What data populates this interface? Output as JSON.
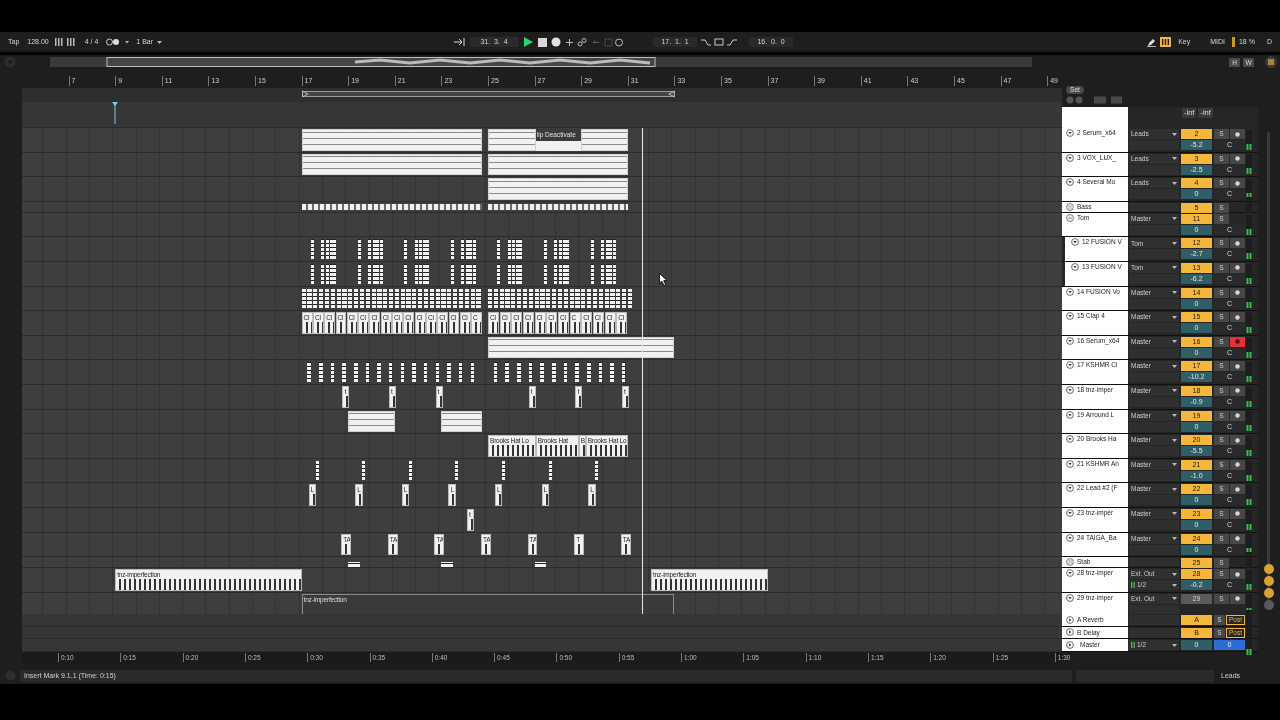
{
  "transport": {
    "tap": "Tap",
    "tempo": "128.00",
    "signature": "4 / 4",
    "quantize": "1 Bar",
    "position": "31.  3.  4",
    "playing": true,
    "loop_start": "17.  1.  1",
    "loop_length": "16.  0.  0",
    "key": "Key",
    "midi": "MIDI",
    "cpu": "18 %",
    "disk": "D"
  },
  "overview": {
    "buttons": [
      "H",
      "W"
    ]
  },
  "ruler": {
    "bars": [
      "7",
      "9",
      "11",
      "13",
      "15",
      "17",
      "19",
      "21",
      "23",
      "25",
      "27",
      "29",
      "31",
      "33",
      "35",
      "37",
      "39",
      "41",
      "43",
      "45",
      "47",
      "49"
    ]
  },
  "mixer_header": {
    "set": "Set",
    "peaks": [
      "-inf",
      "-inf"
    ]
  },
  "tracks": [
    {
      "name": "2 Serum_x64",
      "kind": "track",
      "output": "Leads",
      "number": "2",
      "volume": "-5.2",
      "pan": "C",
      "solo": "S",
      "armed": false,
      "active": true,
      "notice": "lip Deactivate"
    },
    {
      "name": "3 VOX_LUX_",
      "kind": "track",
      "output": "Leads",
      "number": "3",
      "volume": "-2.5",
      "pan": "C",
      "solo": "S",
      "armed": false,
      "active": true
    },
    {
      "name": "4 Several Mo",
      "kind": "track",
      "output": "Leads",
      "number": "4",
      "volume": "0",
      "pan": "C",
      "solo": "S",
      "armed": false,
      "active": true
    },
    {
      "name": "Bass",
      "kind": "group",
      "expanded": false,
      "number": "5",
      "solo": "S",
      "active": true
    },
    {
      "name": "Tom",
      "kind": "group",
      "expanded": true,
      "output": "Master",
      "number": "11",
      "volume": "0",
      "pan": "C",
      "solo": "S",
      "active": true,
      "children": [
        {
          "name": "12 FUSION V",
          "kind": "track",
          "output": "Tom",
          "number": "12",
          "volume": "-2.7",
          "pan": "C",
          "solo": "S",
          "armed": false,
          "active": true
        },
        {
          "name": "13 FUSION V",
          "kind": "track",
          "output": "Tom",
          "number": "13",
          "volume": "-6.2",
          "pan": "C",
          "solo": "S",
          "armed": false,
          "active": true
        }
      ]
    },
    {
      "name": "14 FUSION Vo",
      "kind": "track",
      "output": "Master",
      "number": "14",
      "volume": "0",
      "pan": "C",
      "solo": "S",
      "armed": false,
      "active": true
    },
    {
      "name": "15 Clap 4",
      "kind": "track",
      "output": "Master",
      "number": "15",
      "volume": "0",
      "pan": "C",
      "solo": "S",
      "armed": false,
      "active": true,
      "clips": [
        "Cl",
        "Cl",
        "Cl",
        "Cl",
        "Cl",
        "Cl",
        "Cl",
        "Cl",
        "Cl",
        "Cl",
        "Cl",
        "Cl",
        "Cl",
        "Cl",
        "Cl",
        "C",
        "Cl",
        "Cl",
        "Cl",
        "Cl",
        "Cl",
        "Cl",
        "Cl",
        "C",
        "Cl",
        "Cl",
        "Cl",
        "Cl"
      ]
    },
    {
      "name": "16 Serum_x64",
      "kind": "track",
      "output": "Master",
      "number": "16",
      "volume": "0",
      "pan": "C",
      "solo": "S",
      "armed": true,
      "active": true
    },
    {
      "name": "17 KSHMR Cl",
      "kind": "track",
      "output": "Master",
      "number": "17",
      "volume": "-10.2",
      "pan": "C",
      "solo": "S",
      "armed": false,
      "active": true
    },
    {
      "name": "18 tnz-imper",
      "kind": "track",
      "output": "Master",
      "number": "18",
      "volume": "-0.9",
      "pan": "C",
      "solo": "S",
      "armed": false,
      "active": true,
      "clips": [
        "t",
        "t",
        "t",
        "t",
        "t",
        "t"
      ]
    },
    {
      "name": "19 Arround L",
      "kind": "track",
      "output": "Master",
      "number": "19",
      "volume": "0",
      "pan": "C",
      "solo": "S",
      "armed": false,
      "active": true
    },
    {
      "name": "20 Brooks Ha",
      "kind": "track",
      "output": "Master",
      "number": "20",
      "volume": "-5.5",
      "pan": "C",
      "solo": "S",
      "armed": false,
      "active": true,
      "clips": [
        "Brooks Hat Lo",
        "Brooks Hat",
        "B",
        "Brooks Hat Lo"
      ]
    },
    {
      "name": "21 KSHMR An",
      "kind": "track",
      "output": "Master",
      "number": "21",
      "volume": "-1.0",
      "pan": "C",
      "solo": "S",
      "armed": false,
      "active": true
    },
    {
      "name": "22 Lead #2 (F",
      "kind": "track",
      "output": "Master",
      "number": "22",
      "volume": "0",
      "pan": "C",
      "solo": "S",
      "armed": false,
      "active": true,
      "clips": [
        "L",
        "L",
        "L",
        "L",
        "L",
        "L",
        "L"
      ]
    },
    {
      "name": "23 tnz-imper",
      "kind": "track",
      "output": "Master",
      "number": "23",
      "volume": "0",
      "pan": "C",
      "solo": "S",
      "armed": false,
      "active": true,
      "clips": [
        "t"
      ]
    },
    {
      "name": "24 TAIGA_Ba",
      "kind": "track",
      "output": "Master",
      "number": "24",
      "volume": "0",
      "pan": "C",
      "solo": "S",
      "armed": false,
      "active": true,
      "clips": [
        "TA",
        "TA",
        "TA",
        "TA",
        "TA",
        "T",
        "TA"
      ]
    },
    {
      "name": "Stab",
      "kind": "group",
      "expanded": false,
      "number": "25",
      "solo": "S",
      "active": true
    },
    {
      "name": "28 tnz-imper",
      "kind": "track",
      "output": "Ext. Out",
      "sub_output": "1/2",
      "number": "28",
      "volume": "-0.2",
      "pan": "C",
      "solo": "S",
      "armed": false,
      "active": true,
      "clips": [
        "tnz-imperfection",
        "tnz-imperfection"
      ]
    },
    {
      "name": "29 tnz-imper",
      "kind": "track",
      "output": "Ext. Out",
      "number": "29",
      "solo": "S",
      "armed": false,
      "active": false,
      "clips": [
        "tnz-imperfection"
      ]
    }
  ],
  "returns": [
    {
      "name": "A Reverb",
      "number": "A",
      "solo": "S",
      "send_mode": "Post"
    },
    {
      "name": "B Delay",
      "number": "B",
      "solo": "S",
      "send_mode": "Post"
    }
  ],
  "master": {
    "name": "Master",
    "output": "1/2",
    "number": "0",
    "volume": "0"
  },
  "time_ruler": [
    "0:10",
    "0:15",
    "0:20",
    "0:25",
    "0:30",
    "0:35",
    "0:40",
    "0:45",
    "0:50",
    "0:55",
    "1:00",
    "1:05",
    "1:10",
    "1:15",
    "1:20",
    "1:25",
    "1:30"
  ],
  "status_bar": {
    "message": "Insert Mark 9.1.1 (Time: 0:15)",
    "track": "Leads"
  }
}
